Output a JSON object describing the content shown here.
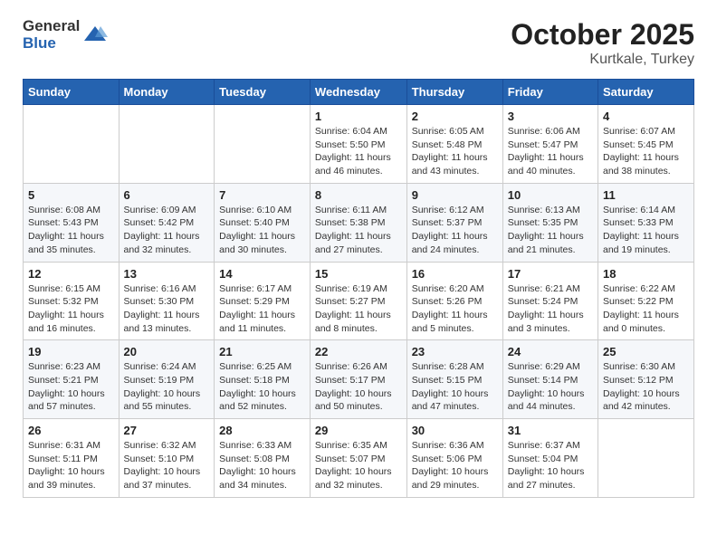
{
  "header": {
    "logo": {
      "text_general": "General",
      "text_blue": "Blue"
    },
    "month": "October 2025",
    "location": "Kurtkale, Turkey"
  },
  "weekdays": [
    "Sunday",
    "Monday",
    "Tuesday",
    "Wednesday",
    "Thursday",
    "Friday",
    "Saturday"
  ],
  "weeks": [
    [
      {
        "day": "",
        "info": ""
      },
      {
        "day": "",
        "info": ""
      },
      {
        "day": "",
        "info": ""
      },
      {
        "day": "1",
        "info": "Sunrise: 6:04 AM\nSunset: 5:50 PM\nDaylight: 11 hours and 46 minutes."
      },
      {
        "day": "2",
        "info": "Sunrise: 6:05 AM\nSunset: 5:48 PM\nDaylight: 11 hours and 43 minutes."
      },
      {
        "day": "3",
        "info": "Sunrise: 6:06 AM\nSunset: 5:47 PM\nDaylight: 11 hours and 40 minutes."
      },
      {
        "day": "4",
        "info": "Sunrise: 6:07 AM\nSunset: 5:45 PM\nDaylight: 11 hours and 38 minutes."
      }
    ],
    [
      {
        "day": "5",
        "info": "Sunrise: 6:08 AM\nSunset: 5:43 PM\nDaylight: 11 hours and 35 minutes."
      },
      {
        "day": "6",
        "info": "Sunrise: 6:09 AM\nSunset: 5:42 PM\nDaylight: 11 hours and 32 minutes."
      },
      {
        "day": "7",
        "info": "Sunrise: 6:10 AM\nSunset: 5:40 PM\nDaylight: 11 hours and 30 minutes."
      },
      {
        "day": "8",
        "info": "Sunrise: 6:11 AM\nSunset: 5:38 PM\nDaylight: 11 hours and 27 minutes."
      },
      {
        "day": "9",
        "info": "Sunrise: 6:12 AM\nSunset: 5:37 PM\nDaylight: 11 hours and 24 minutes."
      },
      {
        "day": "10",
        "info": "Sunrise: 6:13 AM\nSunset: 5:35 PM\nDaylight: 11 hours and 21 minutes."
      },
      {
        "day": "11",
        "info": "Sunrise: 6:14 AM\nSunset: 5:33 PM\nDaylight: 11 hours and 19 minutes."
      }
    ],
    [
      {
        "day": "12",
        "info": "Sunrise: 6:15 AM\nSunset: 5:32 PM\nDaylight: 11 hours and 16 minutes."
      },
      {
        "day": "13",
        "info": "Sunrise: 6:16 AM\nSunset: 5:30 PM\nDaylight: 11 hours and 13 minutes."
      },
      {
        "day": "14",
        "info": "Sunrise: 6:17 AM\nSunset: 5:29 PM\nDaylight: 11 hours and 11 minutes."
      },
      {
        "day": "15",
        "info": "Sunrise: 6:19 AM\nSunset: 5:27 PM\nDaylight: 11 hours and 8 minutes."
      },
      {
        "day": "16",
        "info": "Sunrise: 6:20 AM\nSunset: 5:26 PM\nDaylight: 11 hours and 5 minutes."
      },
      {
        "day": "17",
        "info": "Sunrise: 6:21 AM\nSunset: 5:24 PM\nDaylight: 11 hours and 3 minutes."
      },
      {
        "day": "18",
        "info": "Sunrise: 6:22 AM\nSunset: 5:22 PM\nDaylight: 11 hours and 0 minutes."
      }
    ],
    [
      {
        "day": "19",
        "info": "Sunrise: 6:23 AM\nSunset: 5:21 PM\nDaylight: 10 hours and 57 minutes."
      },
      {
        "day": "20",
        "info": "Sunrise: 6:24 AM\nSunset: 5:19 PM\nDaylight: 10 hours and 55 minutes."
      },
      {
        "day": "21",
        "info": "Sunrise: 6:25 AM\nSunset: 5:18 PM\nDaylight: 10 hours and 52 minutes."
      },
      {
        "day": "22",
        "info": "Sunrise: 6:26 AM\nSunset: 5:17 PM\nDaylight: 10 hours and 50 minutes."
      },
      {
        "day": "23",
        "info": "Sunrise: 6:28 AM\nSunset: 5:15 PM\nDaylight: 10 hours and 47 minutes."
      },
      {
        "day": "24",
        "info": "Sunrise: 6:29 AM\nSunset: 5:14 PM\nDaylight: 10 hours and 44 minutes."
      },
      {
        "day": "25",
        "info": "Sunrise: 6:30 AM\nSunset: 5:12 PM\nDaylight: 10 hours and 42 minutes."
      }
    ],
    [
      {
        "day": "26",
        "info": "Sunrise: 6:31 AM\nSunset: 5:11 PM\nDaylight: 10 hours and 39 minutes."
      },
      {
        "day": "27",
        "info": "Sunrise: 6:32 AM\nSunset: 5:10 PM\nDaylight: 10 hours and 37 minutes."
      },
      {
        "day": "28",
        "info": "Sunrise: 6:33 AM\nSunset: 5:08 PM\nDaylight: 10 hours and 34 minutes."
      },
      {
        "day": "29",
        "info": "Sunrise: 6:35 AM\nSunset: 5:07 PM\nDaylight: 10 hours and 32 minutes."
      },
      {
        "day": "30",
        "info": "Sunrise: 6:36 AM\nSunset: 5:06 PM\nDaylight: 10 hours and 29 minutes."
      },
      {
        "day": "31",
        "info": "Sunrise: 6:37 AM\nSunset: 5:04 PM\nDaylight: 10 hours and 27 minutes."
      },
      {
        "day": "",
        "info": ""
      }
    ]
  ]
}
